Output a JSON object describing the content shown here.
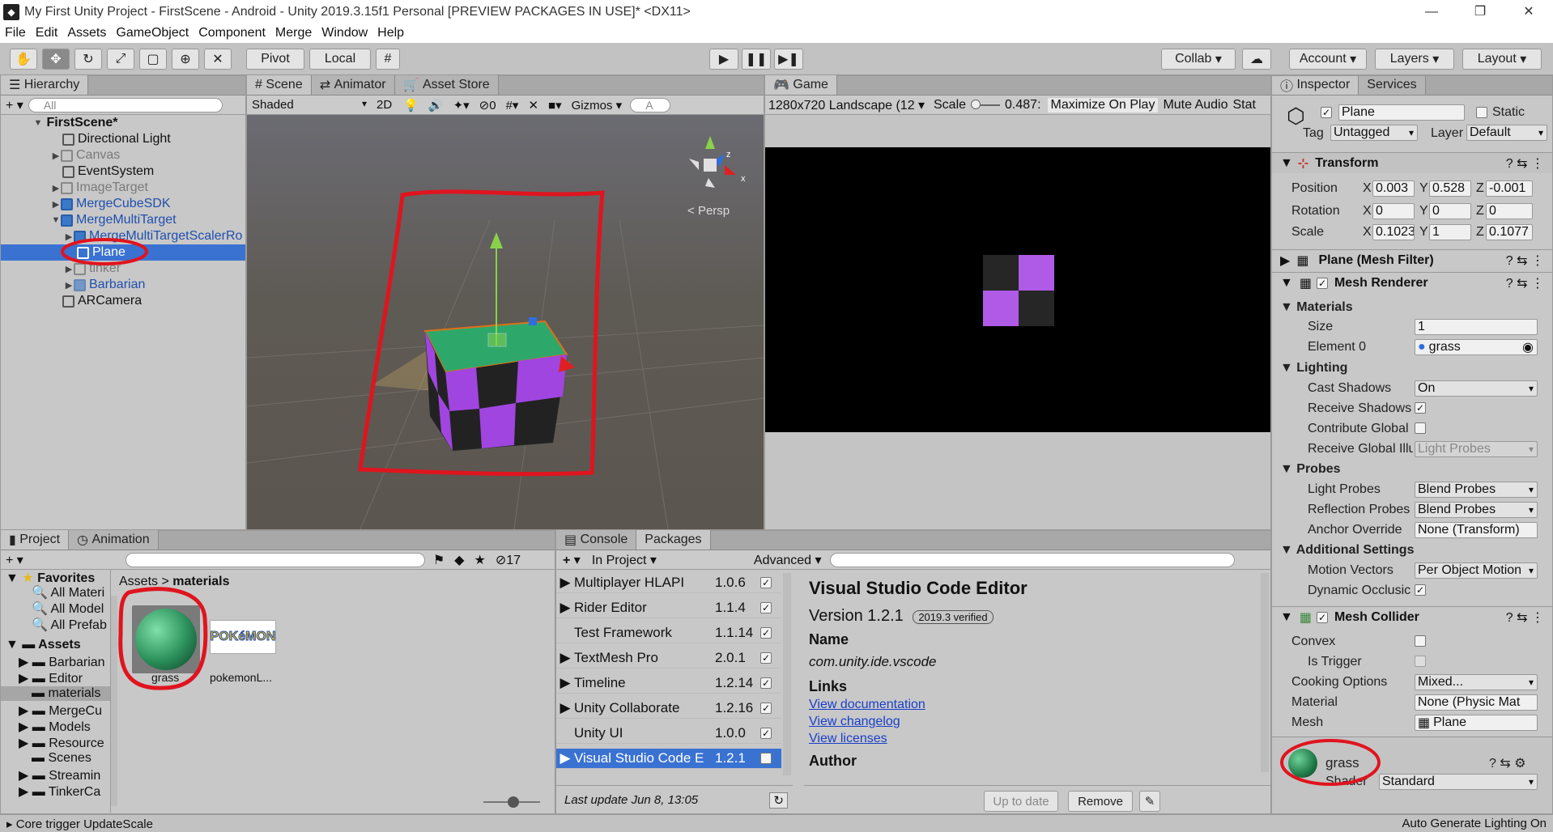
{
  "window": {
    "title": "My First Unity Project - FirstScene - Android - Unity 2019.3.15f1 Personal [PREVIEW PACKAGES IN USE]* <DX11>"
  },
  "menu": [
    "File",
    "Edit",
    "Assets",
    "GameObject",
    "Component",
    "Merge",
    "Window",
    "Help"
  ],
  "toolbar": {
    "pivot": "Pivot",
    "local": "Local",
    "collab": "Collab",
    "account": "Account",
    "layers": "Layers",
    "layout": "Layout"
  },
  "hierarchy": {
    "tab": "Hierarchy",
    "search_placeholder": "All",
    "scene": "FirstScene*",
    "items": [
      {
        "label": "Directional Light"
      },
      {
        "label": "Canvas"
      },
      {
        "label": "EventSystem"
      },
      {
        "label": "ImageTarget"
      },
      {
        "label": "MergeCubeSDK"
      },
      {
        "label": "MergeMultiTarget"
      },
      {
        "label": "MergeMultiTargetScalerRo"
      },
      {
        "label": "Plane"
      },
      {
        "label": "tinker"
      },
      {
        "label": "Barbarian"
      },
      {
        "label": "ARCamera"
      }
    ]
  },
  "scene": {
    "tabs": [
      "Scene",
      "Animator",
      "Asset Store"
    ],
    "shading": "Shaded",
    "mode2d": "2D",
    "gizmos": "Gizmos",
    "persp": "Persp",
    "hidden_count": "0",
    "search_placeholder": "A"
  },
  "game": {
    "tab": "Game",
    "resolution": "1280x720 Landscape (12",
    "scale_label": "Scale",
    "scale_value": "0.487:",
    "maximize": "Maximize On Play",
    "mute": "Mute Audio",
    "stats": "Stat"
  },
  "inspector": {
    "tabs": [
      "Inspector",
      "Services"
    ],
    "name": "Plane",
    "static": "Static",
    "tag_label": "Tag",
    "tag": "Untagged",
    "layer_label": "Layer",
    "layer": "Default",
    "transform": {
      "title": "Transform",
      "position": {
        "label": "Position",
        "x": "0.003",
        "y": "0.528",
        "z": "-0.001"
      },
      "rotation": {
        "label": "Rotation",
        "x": "0",
        "y": "0",
        "z": "0"
      },
      "scale": {
        "label": "Scale",
        "x": "0.1023",
        "y": "1",
        "z": "0.1077"
      }
    },
    "mesh_filter": "Plane (Mesh Filter)",
    "mesh_renderer": {
      "title": "Mesh Renderer",
      "materials": "Materials",
      "size_label": "Size",
      "size": "1",
      "element0_label": "Element 0",
      "element0": "grass",
      "lighting": "Lighting",
      "cast_shadows_label": "Cast Shadows",
      "cast_shadows": "On",
      "receive_shadows": "Receive Shadows",
      "contribute_gi": "Contribute Global",
      "receive_gi_label": "Receive Global Illu",
      "receive_gi": "Light Probes",
      "probes": "Probes",
      "light_probes_label": "Light Probes",
      "light_probes": "Blend Probes",
      "reflection_label": "Reflection Probes",
      "reflection": "Blend Probes",
      "anchor_label": "Anchor Override",
      "anchor": "None (Transform)",
      "additional": "Additional Settings",
      "motion_label": "Motion Vectors",
      "motion": "Per Object Motion",
      "dynamic_occ": "Dynamic Occlusic"
    },
    "mesh_collider": {
      "title": "Mesh Collider",
      "convex": "Convex",
      "is_trigger": "Is Trigger",
      "cooking_label": "Cooking Options",
      "cooking": "Mixed...",
      "material_label": "Material",
      "material": "None (Physic Mat",
      "mesh_label": "Mesh",
      "mesh": "Plane"
    },
    "material_preview": {
      "name": "grass",
      "shader_label": "Shader",
      "shader": "Standard"
    }
  },
  "project": {
    "tabs": [
      "Project",
      "Animation"
    ],
    "hidden_count": "17",
    "favorites": "Favorites",
    "fav_items": [
      "All Materi",
      "All Model",
      "All Prefab"
    ],
    "assets_label": "Assets",
    "folders": [
      "Barbarian",
      "Editor",
      "materials",
      "MergeCu",
      "Models",
      "Resource",
      "Scenes",
      "Streamin",
      "TinkerCa"
    ],
    "breadcrumb": [
      "Assets",
      "materials"
    ],
    "files": [
      {
        "name": "grass"
      },
      {
        "name": "pokemonL..."
      }
    ],
    "logo_text": "POKéMON"
  },
  "packages": {
    "tabs": [
      "Console",
      "Packages"
    ],
    "filter": "In Project",
    "advanced": "Advanced",
    "list": [
      {
        "name": "Multiplayer HLAPI",
        "ver": "1.0.6"
      },
      {
        "name": "Rider Editor",
        "ver": "1.1.4"
      },
      {
        "name": "Test Framework",
        "ver": "1.1.14"
      },
      {
        "name": "TextMesh Pro",
        "ver": "2.0.1"
      },
      {
        "name": "Timeline",
        "ver": "1.2.14"
      },
      {
        "name": "Unity Collaborate",
        "ver": "1.2.16"
      },
      {
        "name": "Unity UI",
        "ver": "1.0.0"
      },
      {
        "name": "Visual Studio Code E",
        "ver": "1.2.1"
      }
    ],
    "last_update": "Last update Jun 8, 13:05",
    "detail": {
      "title": "Visual Studio Code Editor",
      "version": "Version 1.2.1",
      "verified": "2019.3 verified",
      "name_label": "Name",
      "name": "com.unity.ide.vscode",
      "links_label": "Links",
      "links": [
        "View documentation",
        "View changelog",
        "View licenses"
      ],
      "author_label": "Author"
    },
    "uptodate": "Up to date",
    "remove": "Remove"
  },
  "status": {
    "left": "Core trigger UpdateScale",
    "right": "Auto Generate Lighting On"
  },
  "colors": {
    "selection": "#3a72d2",
    "annotation": "#e0141e",
    "prefab": "#1f4fae",
    "cube_purple": "#a045e0"
  }
}
